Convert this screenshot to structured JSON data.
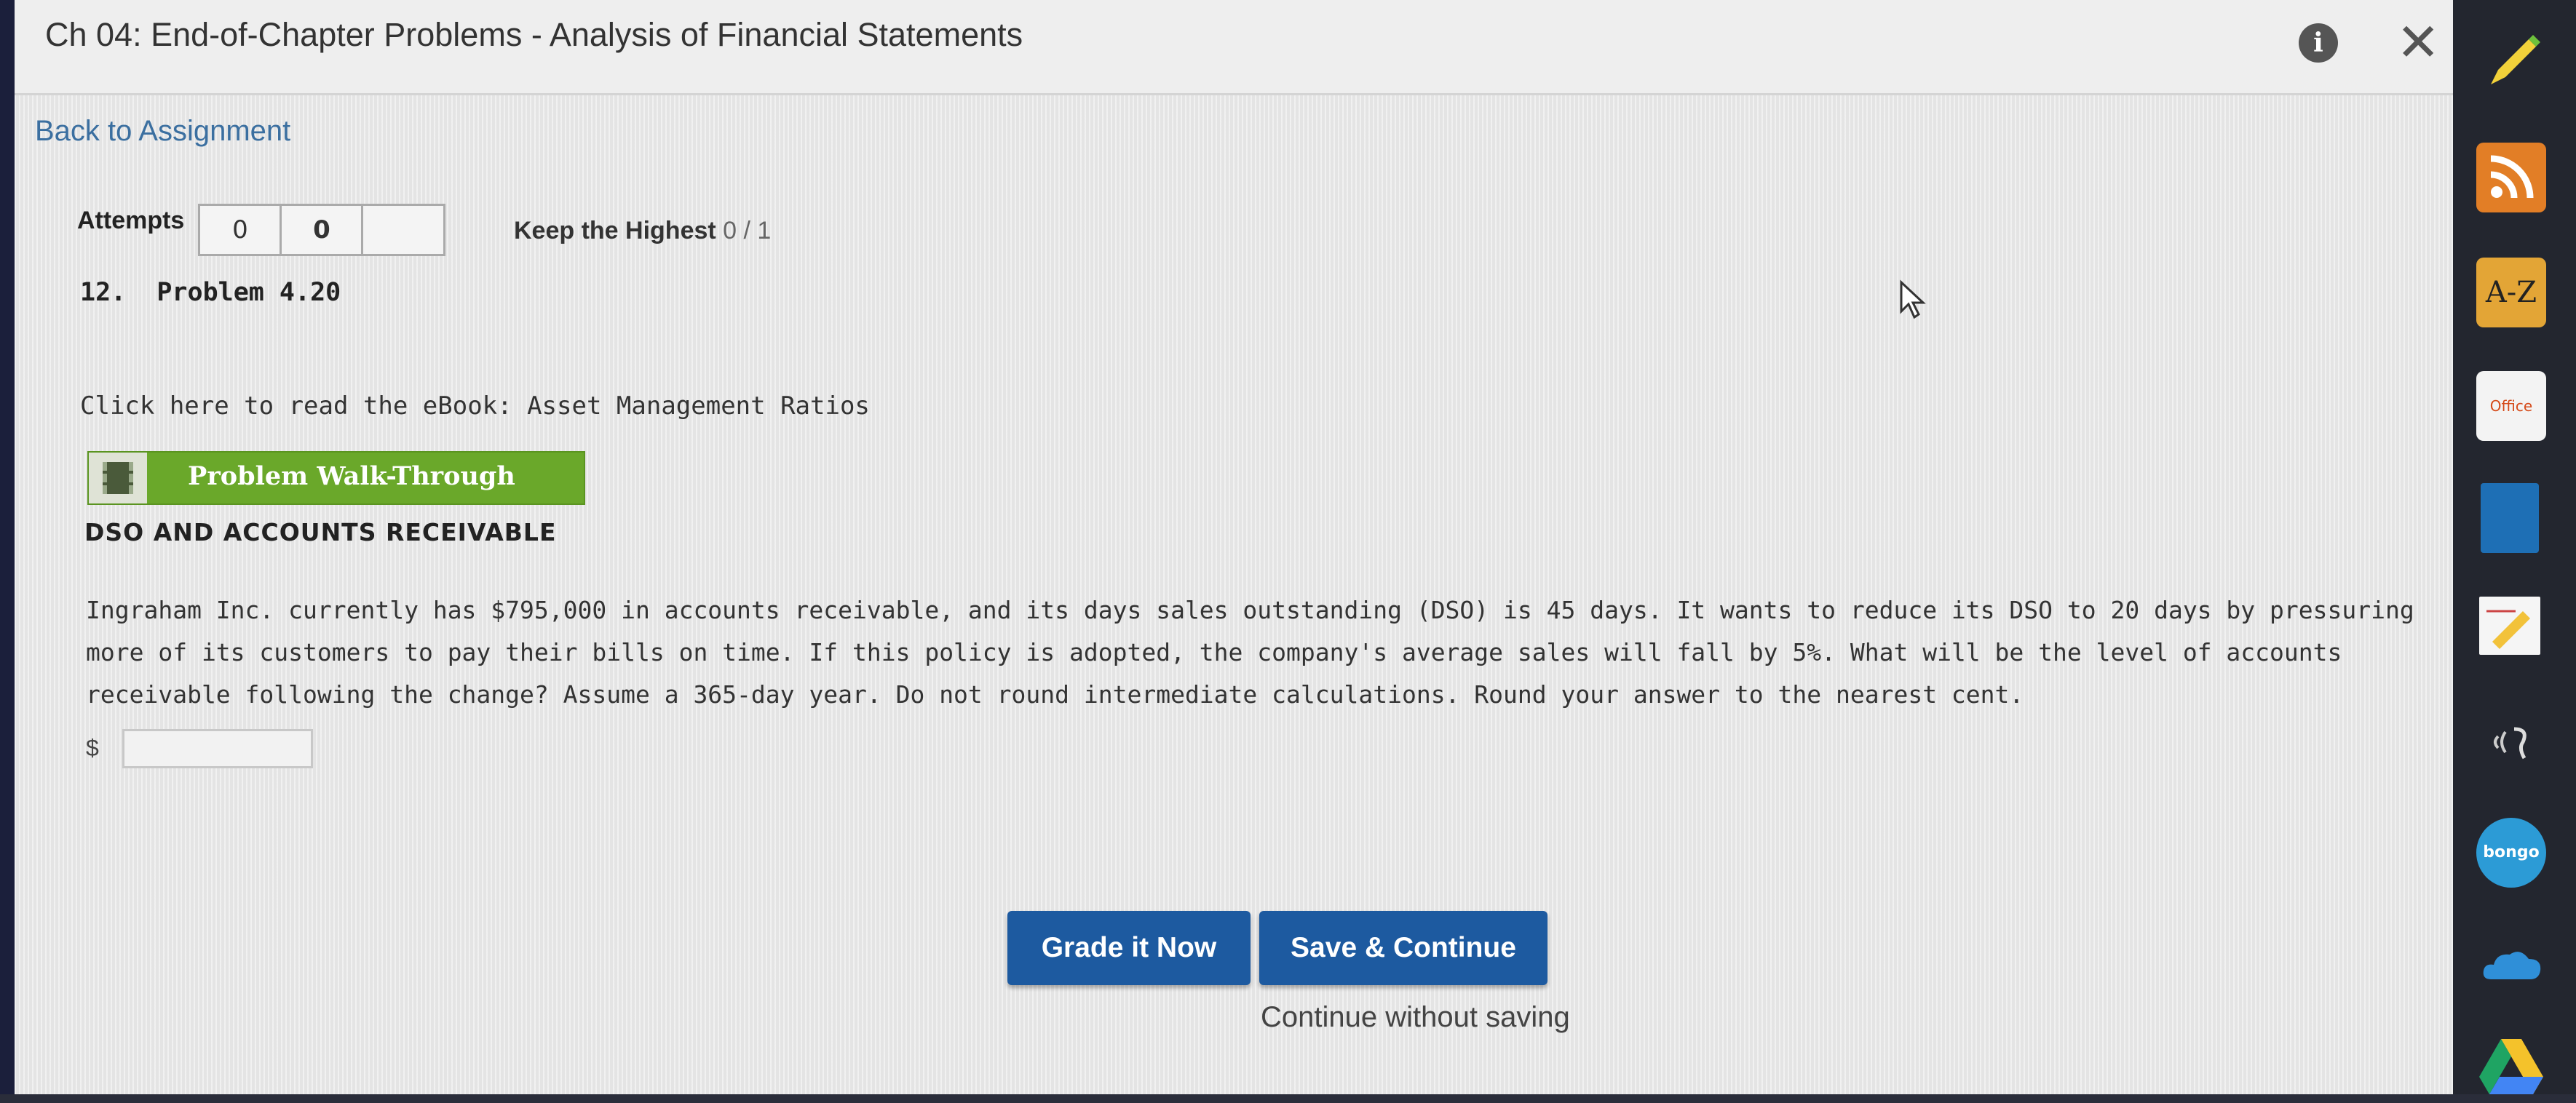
{
  "header": {
    "title": "Ch 04: End-of-Chapter Problems - Analysis of Financial Statements",
    "info_icon": "info-icon",
    "close_icon": "close-icon"
  },
  "nav": {
    "back_label": "Back to Assignment"
  },
  "attempts": {
    "label": "Attempts",
    "boxes": [
      "0",
      "0",
      ""
    ],
    "keep_label": "Keep the Highest",
    "keep_score": "0 / 1"
  },
  "problem": {
    "number_title": "12.  Problem 4.20",
    "ebook_link": "Click here to read the eBook: Asset Management Ratios",
    "walkthrough_label": "Problem Walk-Through",
    "section_heading": "DSO AND ACCOUNTS RECEIVABLE",
    "text": "Ingraham Inc. currently has $795,000 in accounts receivable, and its days sales outstanding (DSO) is 45 days. It wants to reduce its DSO to 20 days by pressuring more of its customers to pay their bills on time. If this policy is adopted, the company's average sales will fall by 5%. What will be the level of accounts receivable following the change? Assume a 365-day year. Do not round intermediate calculations. Round your answer to the nearest cent.",
    "currency_symbol": "$",
    "answer_value": ""
  },
  "actions": {
    "grade_label": "Grade it Now",
    "save_label": "Save & Continue",
    "continue_label": "Continue without saving"
  },
  "toolbar": {
    "items": [
      "pencil-icon",
      "rss-icon",
      "az-icon",
      "office-icon",
      "book-icon",
      "note-icon",
      "speech-icon",
      "bongo-icon",
      "cloud-icon",
      "drive-icon"
    ],
    "az_label": "A-Z",
    "office_label": "Office",
    "bongo_label": "bongo"
  },
  "colors": {
    "accent_button": "#1d5aa0",
    "walkthrough_green": "#6aa82a",
    "link_blue": "#3b6fa0"
  }
}
